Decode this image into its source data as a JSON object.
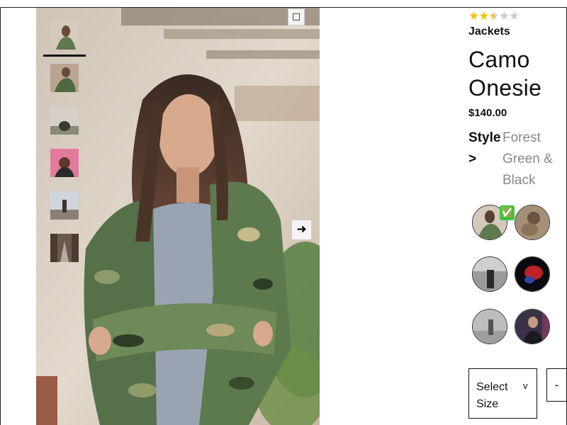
{
  "gallery": {
    "expand_icon": "□",
    "next_icon": "➜",
    "thumbnails": [
      {
        "alt": "camo-jacket-front"
      },
      {
        "alt": "camo-jacket-crouch"
      },
      {
        "alt": "dog-outdoor"
      },
      {
        "alt": "dark-outfit-pink-wall"
      },
      {
        "alt": "street-walk"
      },
      {
        "alt": "city-road"
      }
    ]
  },
  "product": {
    "rating": 2.5,
    "rating_max": 5,
    "category": "Jackets",
    "title": "Camo Onesie",
    "price": "$140.00",
    "style_label": "Style >",
    "style_value": "Forest Green & Black",
    "check_icon": "✅",
    "size_select_label": "Select Size",
    "size_caret": "v",
    "qty_minus": "-"
  },
  "colors": {
    "star_filled": "#f2c200",
    "star_empty": "#cccccc",
    "check_green": "#2ecc40",
    "style_value_gray": "#888888"
  }
}
